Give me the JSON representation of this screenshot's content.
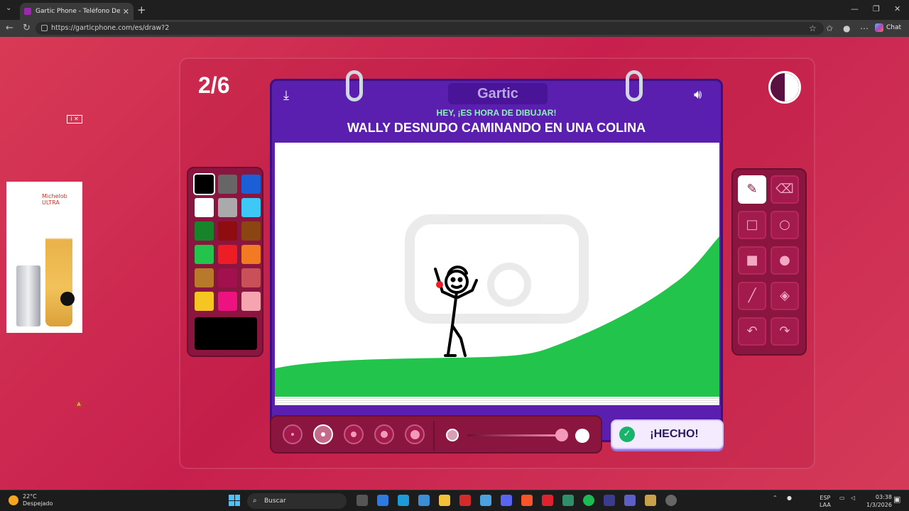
{
  "browser": {
    "tab_title": "Gartic Phone - Teléfono Descomp",
    "new_tab": "+",
    "url": "https://garticphone.com/es/draw?2",
    "chat_label": "Chat"
  },
  "game": {
    "round": "2/6",
    "logo": "Gartic",
    "hint": "HEY, ¡ES HORA DE DIBUJAR!",
    "prompt": "WALLY DESNUDO CAMINANDO EN UNA COLINA",
    "done_label": "¡HECHO!",
    "timer_remaining": 0.5
  },
  "palette": {
    "colors": [
      "#000000",
      "#666666",
      "#1a5fd6",
      "#ffffff",
      "#aaaaaa",
      "#3ec8f5",
      "#16852a",
      "#8e0d10",
      "#8b4513",
      "#22c44b",
      "#ee1c24",
      "#f27a22",
      "#b8792a",
      "#a3104e",
      "#c95058",
      "#f5c622",
      "#ee1281",
      "#f6a5b0"
    ],
    "selected": "#000000",
    "current": "#000000"
  },
  "tools": [
    "pencil-icon",
    "eraser-icon",
    "rectangle-outline-icon",
    "ellipse-outline-icon",
    "rectangle-fill-icon",
    "ellipse-fill-icon",
    "line-icon",
    "fill-bucket-icon",
    "undo-icon",
    "redo-icon"
  ],
  "selected_tool": "pencil-icon",
  "brush_sizes": [
    1,
    2,
    3,
    4,
    5
  ],
  "selected_brush_size": 2,
  "ads": {
    "small_icon": "i ✕",
    "banner_brand": "Michelob ULTRA",
    "banner_corner": "A"
  },
  "taskbar": {
    "temperature": "22°C",
    "weather": "Despejado",
    "search_placeholder": "Buscar",
    "lang_1": "ESP",
    "lang_2": "LAA",
    "time": "03:38",
    "date": "1/3/2026"
  }
}
